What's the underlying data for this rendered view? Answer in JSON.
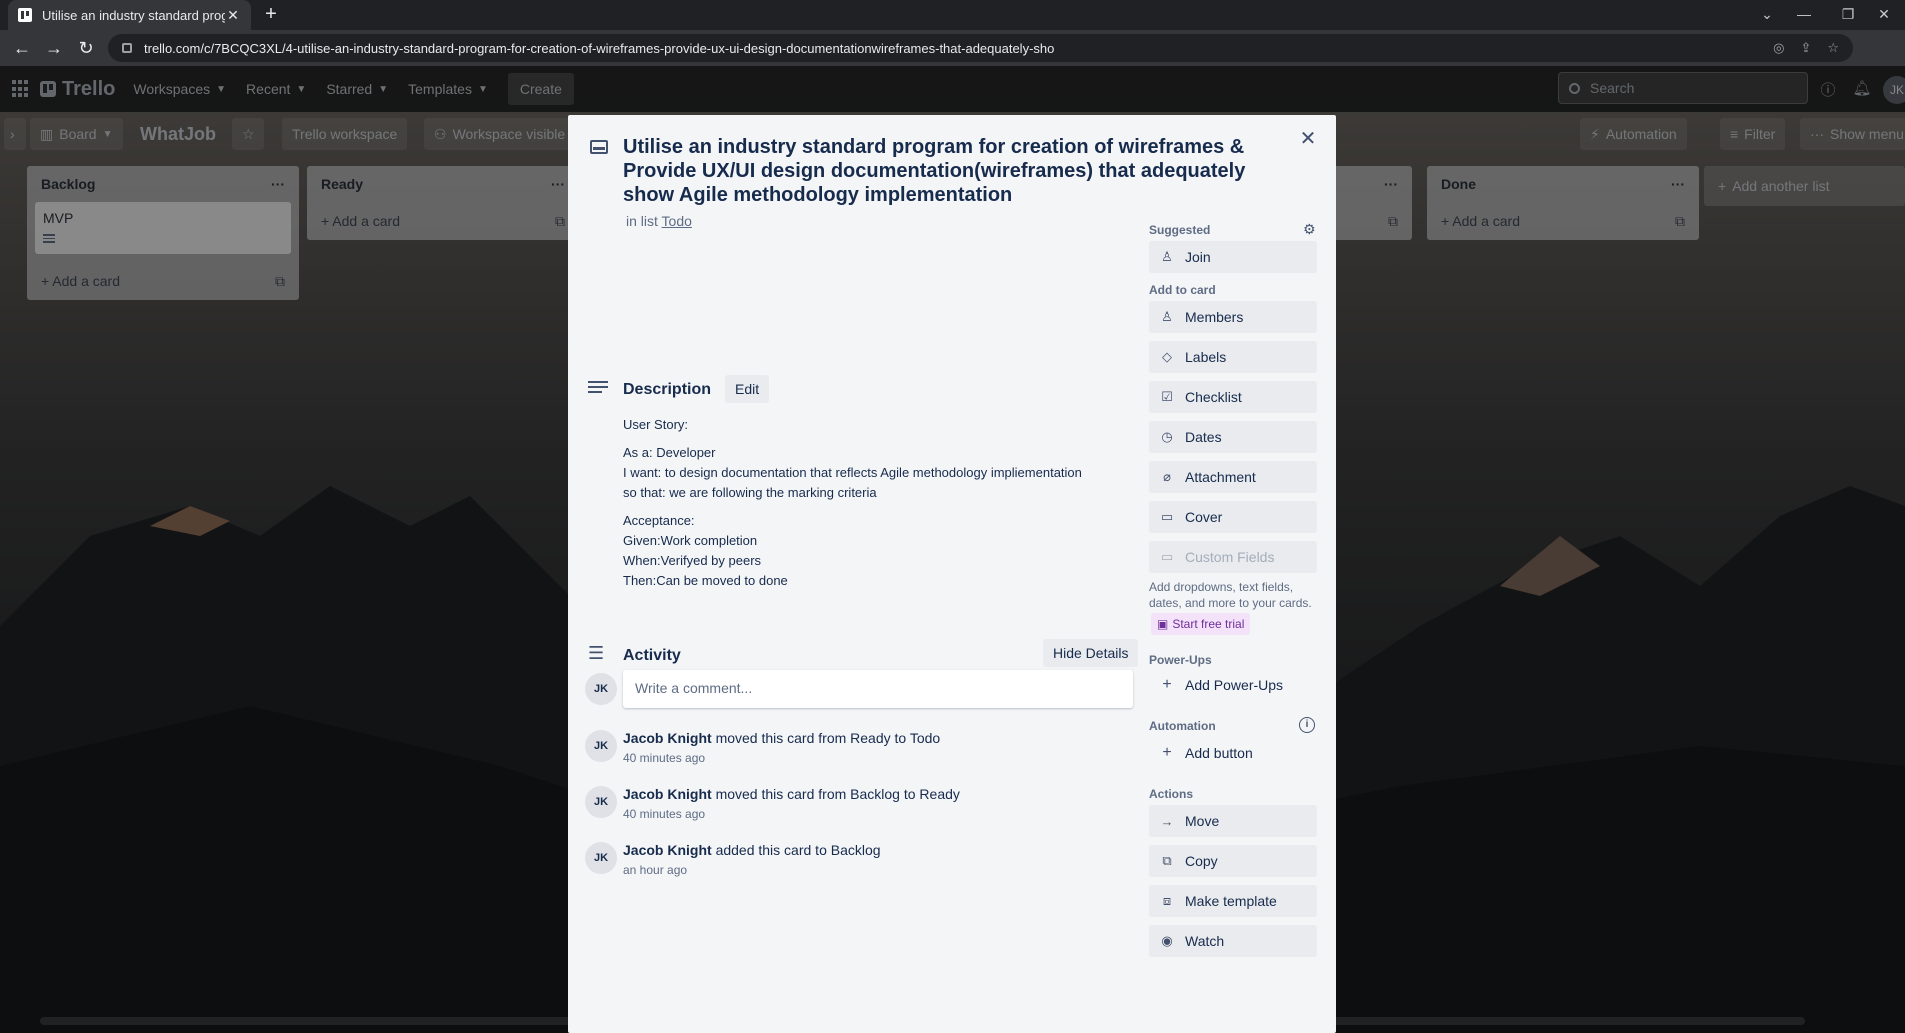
{
  "browser": {
    "tab_title": "Utilise an industry standard prog",
    "tab_close": "✕",
    "new_tab": "+",
    "url": "trello.com/c/7BCQC3XL/4-utilise-an-industry-standard-program-for-creation-of-wireframes-provide-ux-ui-design-documentationwireframes-that-adequately-sho"
  },
  "header": {
    "logo": "Trello",
    "nav": [
      "Workspaces",
      "Recent",
      "Starred",
      "Templates"
    ],
    "create": "Create",
    "search_placeholder": "Search",
    "avatar": "JK"
  },
  "board": {
    "view": "Board",
    "name": "WhatJob",
    "workspace": "Trello workspace",
    "visibility": "Workspace visible",
    "automation": "Automation",
    "filter": "Filter",
    "show_menu": "Show menu"
  },
  "lists": [
    {
      "title": "Backlog",
      "cards": [
        "MVP"
      ],
      "add": "Add a card"
    },
    {
      "title": "Ready",
      "cards": [],
      "add": "Add a card"
    },
    {
      "title": "Done",
      "cards": [],
      "add": "Add a card"
    }
  ],
  "add_another_list": "Add another list",
  "card": {
    "title": "Utilise an industry standard program for creation of wireframes & Provide UX/UI design documentation(wireframes) that adequately show Agile methodology implementation",
    "in_list_prefix": "in list",
    "in_list": "Todo",
    "description_heading": "Description",
    "edit": "Edit",
    "description": {
      "story_label": "User Story:",
      "as_a": "As a: Developer",
      "i_want": "I want: to design documentation that reflects Agile methodology impliementation",
      "so_that": "so that: we are following the marking criteria",
      "acceptance_label": "Acceptance:",
      "given": "Given:Work completion",
      "when": "When:Verifyed by peers",
      "then": "Then:Can be moved to done"
    },
    "activity_heading": "Activity",
    "hide_details": "Hide Details",
    "comment_placeholder": "Write a comment...",
    "user_initials": "JK",
    "activity": [
      {
        "user": "Jacob Knight",
        "action": "moved this card from Ready to Todo",
        "time": "40 minutes ago"
      },
      {
        "user": "Jacob Knight",
        "action": "moved this card from Backlog to Ready",
        "time": "40 minutes ago"
      },
      {
        "user": "Jacob Knight",
        "action": "added this card to Backlog",
        "time": "an hour ago"
      }
    ]
  },
  "sidebar": {
    "suggested": "Suggested",
    "join": "Join",
    "add_to_card": "Add to card",
    "add_items": [
      "Members",
      "Labels",
      "Checklist",
      "Dates",
      "Attachment",
      "Cover",
      "Custom Fields"
    ],
    "custom_fields_help": "Add dropdowns, text fields, dates, and more to your cards.",
    "start_trial": "Start free trial",
    "powerups": "Power-Ups",
    "add_powerups": "Add Power-Ups",
    "automation": "Automation",
    "add_button": "Add button",
    "actions": "Actions",
    "action_items": [
      "Move",
      "Copy",
      "Make template",
      "Watch"
    ]
  },
  "colors": {
    "modal_bg": "#f4f5f7",
    "button_bg": "#e9ebee",
    "text": "#172b4d",
    "trial_bg": "#f3e2fa"
  }
}
